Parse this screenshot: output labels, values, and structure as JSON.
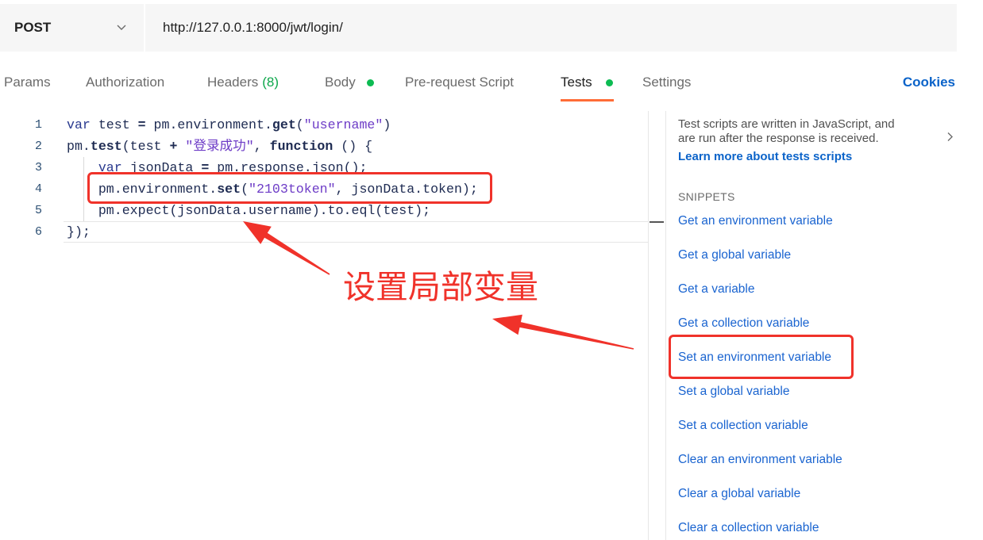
{
  "request": {
    "method": "POST",
    "url": "http://127.0.0.1:8000/jwt/login/"
  },
  "tabs": {
    "params": "Params",
    "authorization": "Authorization",
    "headers": "Headers",
    "headers_count": "(8)",
    "body": "Body",
    "pre_request": "Pre-request Script",
    "tests": "Tests",
    "settings": "Settings",
    "cookies": "Cookies"
  },
  "editor": {
    "line_numbers": [
      "1",
      "2",
      "3",
      "4",
      "5",
      "6"
    ],
    "lines": [
      [
        "var",
        " test ",
        "=",
        " pm.environment.",
        "get",
        "(",
        "\"username\"",
        ")"
      ],
      [
        "pm.",
        "test",
        "(test ",
        "+",
        " ",
        "\"登录成功\"",
        ", ",
        "function",
        " () {"
      ],
      [
        "    ",
        "var",
        " jsonData ",
        "=",
        " pm.response.json();"
      ],
      [
        "    pm.environment.",
        "set",
        "(",
        "\"2103token\"",
        ", jsonData.token);"
      ],
      [
        "    pm.expect(jsonData.username).to.eql(test);"
      ],
      [
        "});"
      ]
    ]
  },
  "sidebar": {
    "description": "Test scripts are written in JavaScript, and are run after the response is received.",
    "learn_more": "Learn more about tests scripts",
    "snippets_heading": "SNIPPETS",
    "snippets": [
      "Get an environment variable",
      "Get a global variable",
      "Get a variable",
      "Get a collection variable",
      "Set an environment variable",
      "Set a global variable",
      "Set a collection variable",
      "Clear an environment variable",
      "Clear a global variable",
      "Clear a collection variable"
    ]
  },
  "annotation": {
    "label": "设置局部变量"
  },
  "icons": {
    "method_dropdown": "chevron-down-icon",
    "sidebar_toggle": "chevron-right-icon",
    "tab_status": "status-dot-icon"
  },
  "colors": {
    "active_tab_accent": "#ff6c37",
    "link": "#0b63c9",
    "status_green": "#0cbb52",
    "annotation_red": "#f0322a"
  }
}
